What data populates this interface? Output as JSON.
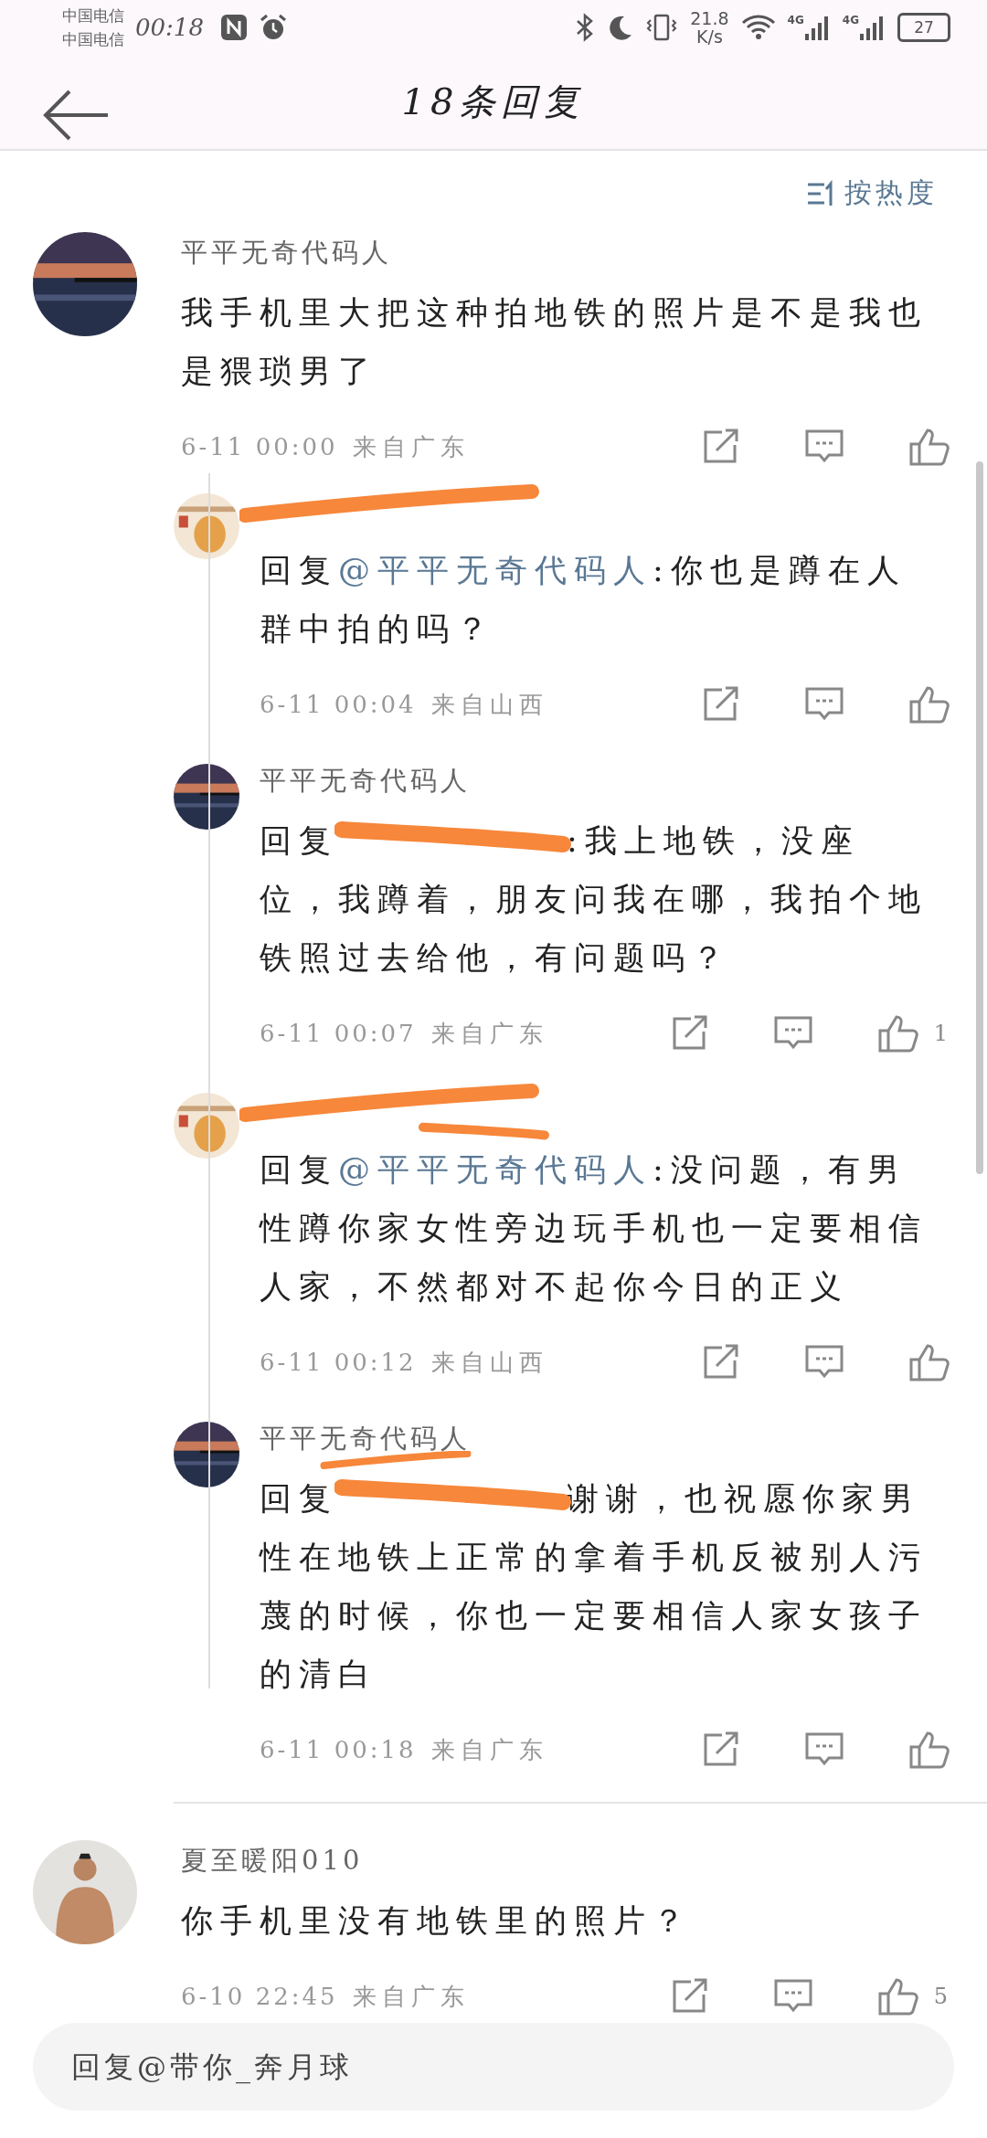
{
  "status_bar": {
    "carriers": [
      "中国电信",
      "中国电信"
    ],
    "time": "00:18",
    "net_speed": [
      "21.8",
      "K/s"
    ],
    "network_labels": [
      "4G",
      "4G"
    ],
    "battery": "27"
  },
  "header": {
    "title": "18条回复"
  },
  "sort": {
    "label": "按热度"
  },
  "comments": [
    {
      "name": "平平无奇代码人",
      "name_redacted": false,
      "text": "我手机里大把这种拍地铁的照片是不是我也是猥琐男了",
      "time": "6-11 00:00",
      "location": "来自广东",
      "replies": [
        {
          "name_redacted": true,
          "prefix": "回复",
          "mention": "@平平无奇代码人",
          "mention_redacted": false,
          "text": ":你也是蹲在人群中拍的吗？",
          "time": "6-11 00:04",
          "location": "来自山西"
        },
        {
          "name": "平平无奇代码人",
          "name_redacted": false,
          "prefix": "回复",
          "mention_redacted": true,
          "text": ":我上地铁，没座位，我蹲着，朋友问我在哪，我拍个地铁照过去给他，有问题吗？",
          "time": "6-11 00:07",
          "location": "来自广东",
          "like_count": "1"
        },
        {
          "name_redacted": true,
          "prefix": "回复",
          "mention": "@平平无奇代码人",
          "mention_redacted": true,
          "text": ":没问题，有男性蹲你家女性旁边玩手机也一定要相信人家，不然都对不起你今日的正义",
          "time": "6-11 00:12",
          "location": "来自山西"
        },
        {
          "name": "平平无奇代码人",
          "name_redacted": true,
          "prefix": "回复",
          "mention_redacted": true,
          "text": "谢谢，也祝愿你家男性在地铁上正常的拿着手机反被别人污蔑的时候，你也一定要相信人家女孩子的清白",
          "time": "6-11 00:18",
          "location": "来自广东"
        }
      ]
    },
    {
      "name": "夏至暖阳010",
      "name_redacted": false,
      "text": "你手机里没有地铁里的照片？",
      "time": "6-10 22:45",
      "location": "来自广东",
      "like_count": "5"
    }
  ],
  "reply_box": {
    "placeholder": "回复@带你_奔月球"
  }
}
